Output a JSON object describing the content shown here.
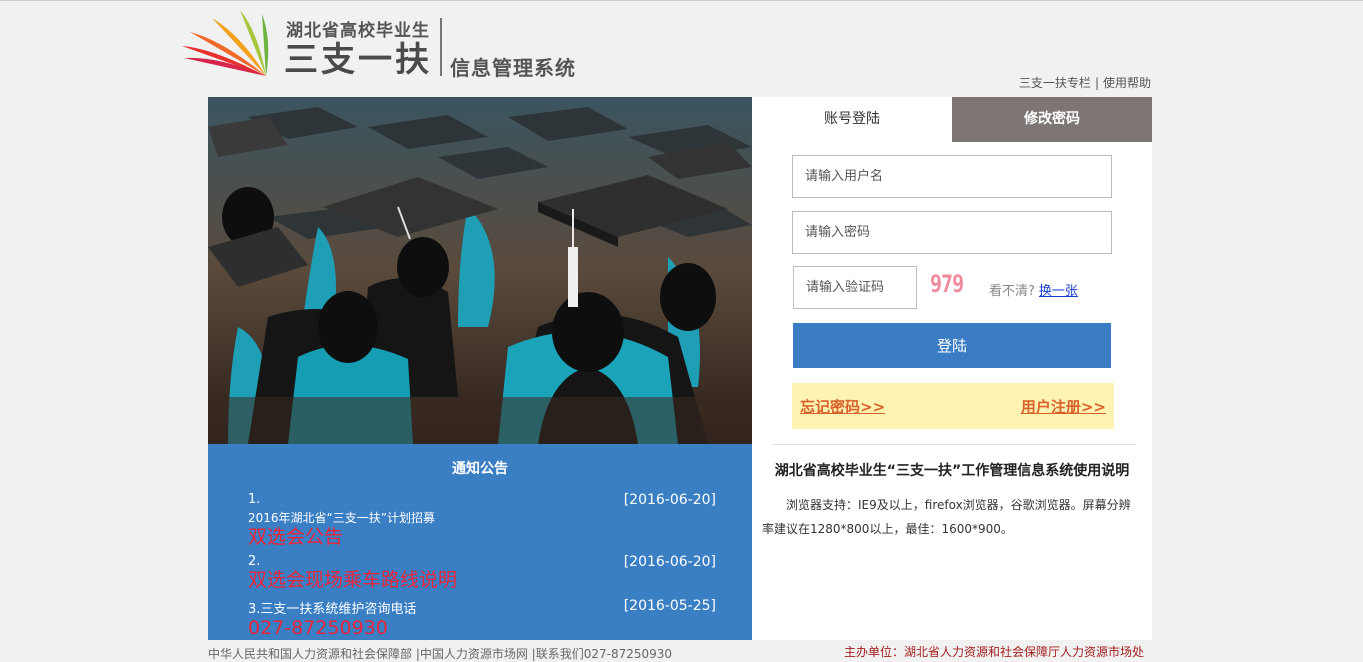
{
  "header": {
    "logo_subtitle": "湖北省高校毕业生",
    "logo_title": "三支一扶",
    "logo_suffix": "信息管理系统",
    "links": [
      "三支一扶专栏",
      "使用帮助"
    ]
  },
  "tabs": {
    "login": "账号登陆",
    "change_password": "修改密码"
  },
  "form": {
    "username_placeholder": "请输入用户名",
    "password_placeholder": "请输入密码",
    "captcha_placeholder": "请输入验证码",
    "captcha_code": "979",
    "captcha_hint": "看不清?",
    "captcha_refresh": "换一张",
    "submit": "登陆",
    "forgot": "忘记密码>>",
    "register": "用户注册>>"
  },
  "notice": {
    "title": "通知公告",
    "items": [
      {
        "num": "1.",
        "date": "[2016-06-20]",
        "line": "2016年湖北省“三支一扶”计划招募",
        "red": "双选会公告"
      },
      {
        "num": "2.",
        "date": "[2016-06-20]",
        "line": "",
        "red": "双选会现场乘车路线说明"
      },
      {
        "num": "3.三支一扶系统维护咨询电话",
        "date": "[2016-05-25]",
        "line": "",
        "red": "027-87250930"
      }
    ]
  },
  "guide": {
    "title": "湖北省高校毕业生“三支一扶”工作管理信息系统使用说明",
    "text": "浏览器支持：IE9及以上，firefox浏览器，谷歌浏览器。屏幕分辨率建议在1280*800以上，最佳：1600*900。"
  },
  "footer": {
    "left": "中华人民共和国人力资源和社会保障部 |中国人力资源市场网 |联系我们027-87250930",
    "right": "主办单位：湖北省人力资源和社会保障厅人力资源市场处"
  },
  "colors": {
    "primary": "#3a7fc4",
    "tab_inactive": "#7d7674",
    "link_orange": "#d9612a",
    "notice_red": "#e8253a"
  }
}
